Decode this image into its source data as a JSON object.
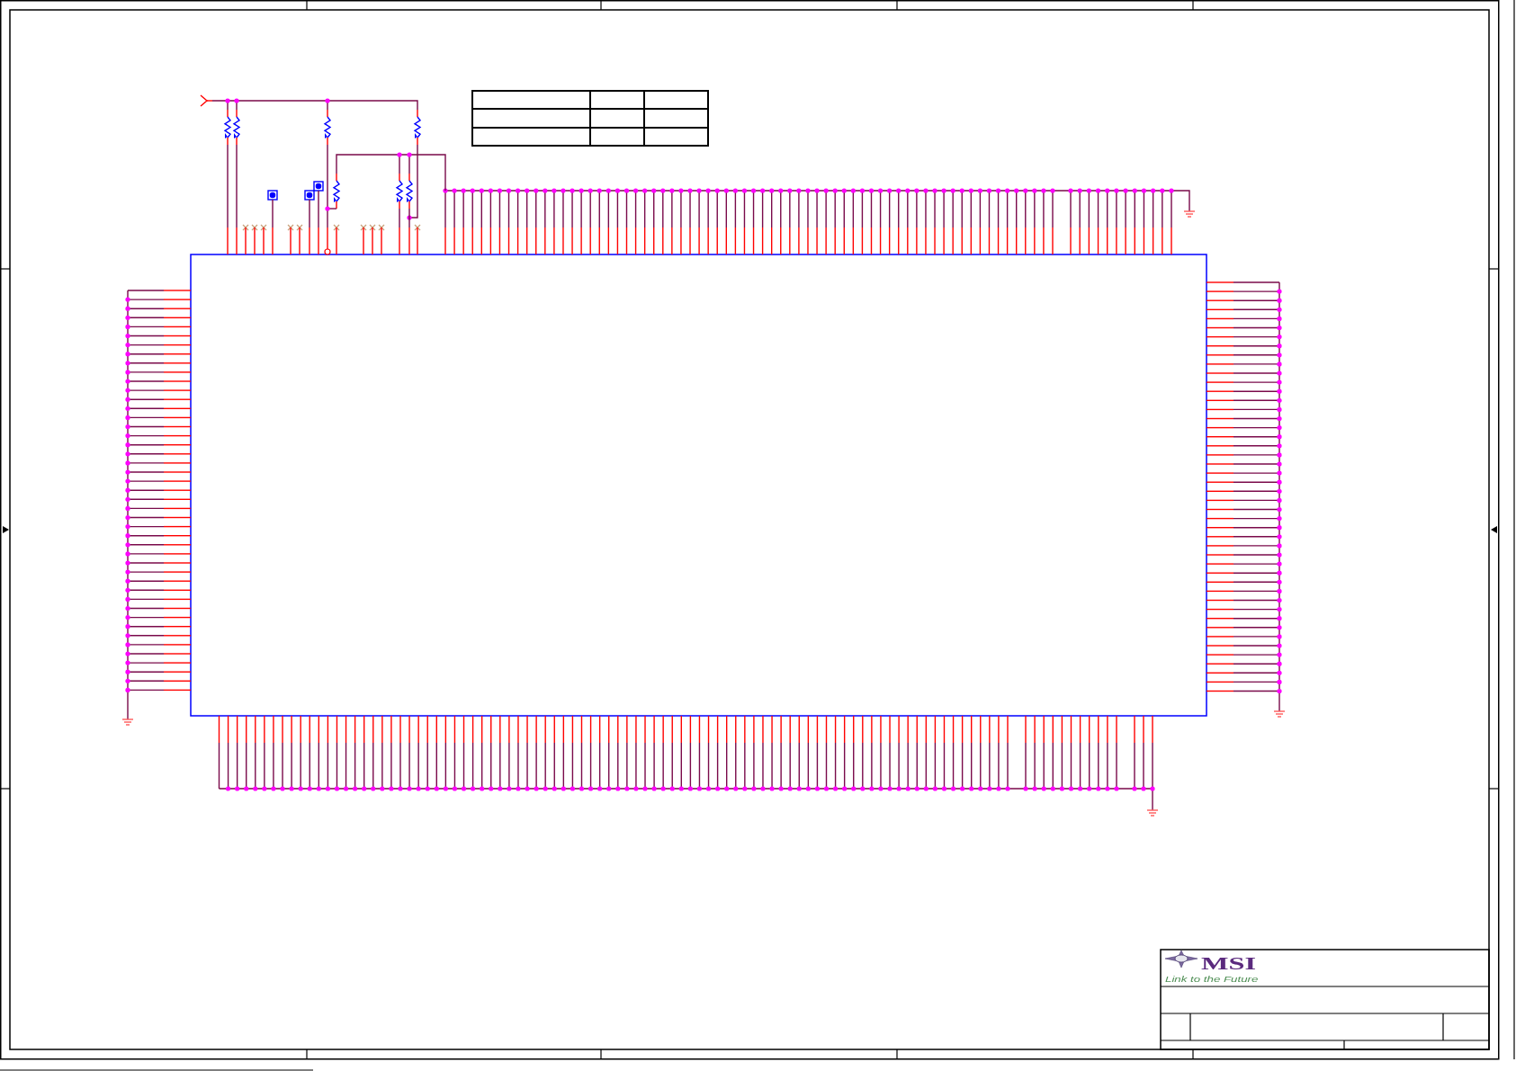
{
  "title_block": {
    "logo_text": "MSI",
    "tagline": "Link to the Future"
  }
}
